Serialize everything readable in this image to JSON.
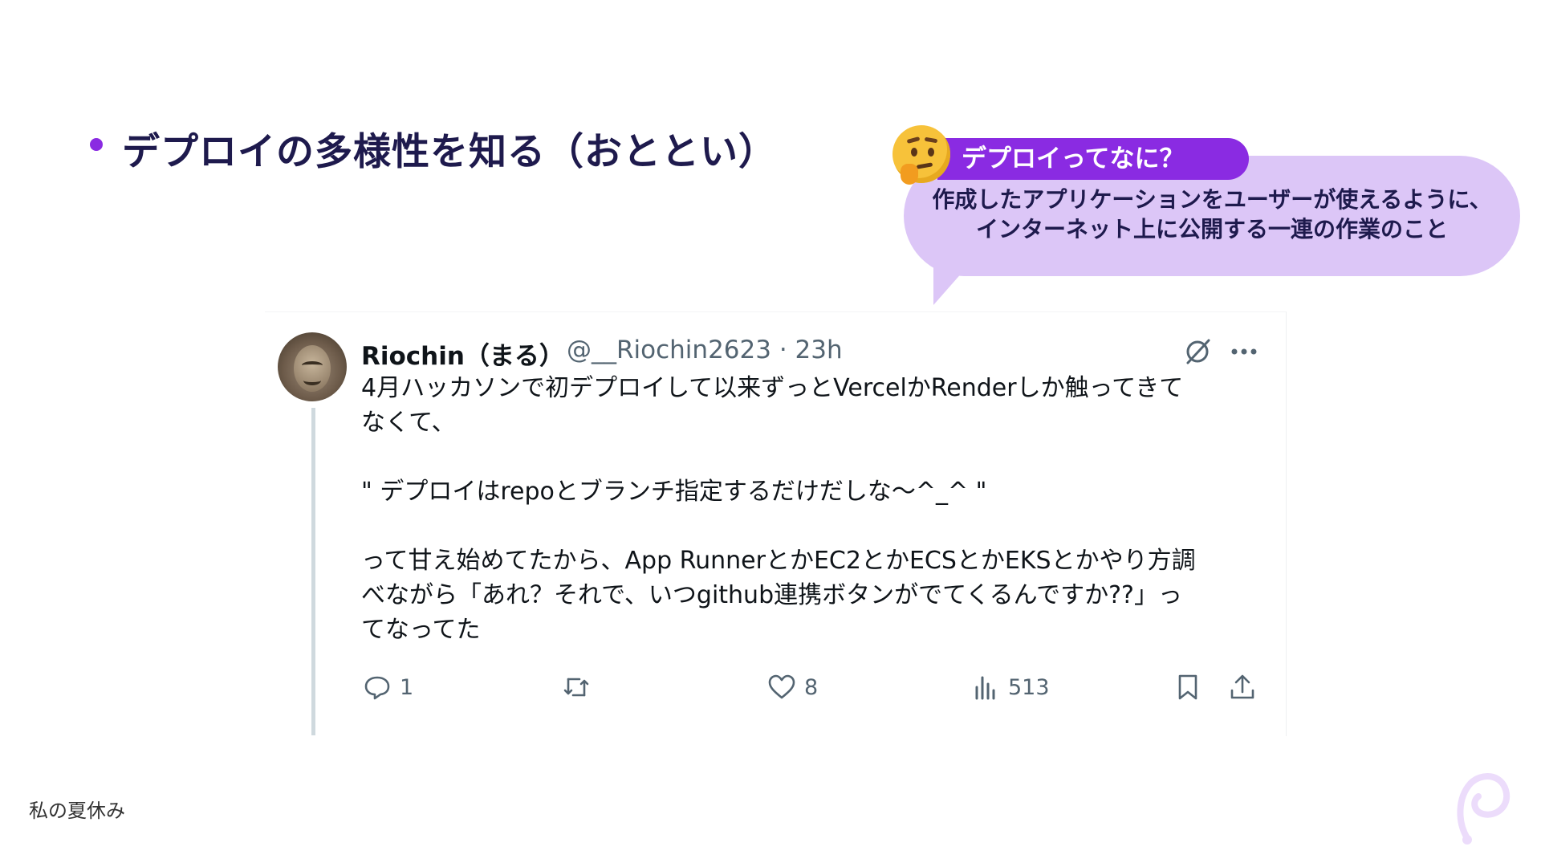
{
  "slide": {
    "heading": "デプロイの多様性を知る（おととい）",
    "footer": "私の夏休み"
  },
  "callout": {
    "label": "デプロイってなに？",
    "line1": "作成したアプリケーションをユーザーが使えるように、",
    "line2": "インターネット上に公開する一連の作業のこと",
    "icon": "thinking-face-emoji"
  },
  "tweet": {
    "name": "Riochin（まる）",
    "handle": "@__Riochin2623 · 23h",
    "body": [
      "4月ハッカソンで初デプロイして以来ずっとVercelかRenderしか触ってきて\nなくて、",
      "\" デプロイはrepoとブランチ指定するだけだしな〜^_^ \"",
      "って甘え始めてたから、App RunnerとかEC2とかECSとかEKSとかやり方調\nべながら「あれ？それで、いつgithub連携ボタンがでてくるんですか??」っ\nてなってた"
    ],
    "replies": "1",
    "likes": "8",
    "views": "513"
  },
  "colors": {
    "accent": "#8a2be2",
    "bubble": "#dcc6f7",
    "heading": "#1e1a4d"
  }
}
